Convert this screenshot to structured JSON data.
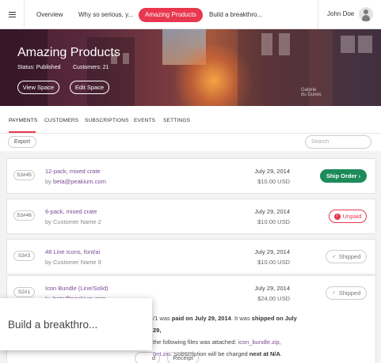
{
  "topnav": {
    "tabs": [
      {
        "label": "Overview"
      },
      {
        "label": "Why so serious, y..."
      },
      {
        "label": "Amazing Products",
        "active": true
      },
      {
        "label": "Build a breakthro..."
      }
    ],
    "user_name": "John Doe",
    "accent_color": "#e8374e"
  },
  "hero": {
    "title": "Amazing Products",
    "status": "Status: Published",
    "customers": "Customers: 21",
    "view_button": "View Space",
    "edit_button": "Edit Space",
    "sign_text": "Galerie\ndu Dunes"
  },
  "tabs": [
    {
      "label": "PAYMENTS",
      "active": true
    },
    {
      "label": "CUSTOMERS"
    },
    {
      "label": "SUBSCRIPTIONS"
    },
    {
      "label": "EVENTS"
    },
    {
      "label": "SETTINGS"
    }
  ],
  "toolbar": {
    "export_label": "Export",
    "search_placeholder": "Search"
  },
  "payments": [
    {
      "id": "S3#45",
      "product": "12-pack, mixed crate",
      "by": "by ",
      "customer": "beta@peakium.com",
      "date": "July 29, 2014",
      "price": "$10.00 USD",
      "action": "Ship Order",
      "action_glyph": "›"
    },
    {
      "id": "S3#46",
      "product": "6-pack, mixed crate",
      "by": "by Customer Name 2",
      "customer": "",
      "date": "July 29, 2014",
      "price": "$10.00 USD",
      "action": "Unpaid",
      "action_glyph": "!"
    },
    {
      "id": "S3#3",
      "product": "48 Line Icons, font/ai",
      "by": "by Customer Name 9",
      "customer": "",
      "date": "July 29, 2014",
      "price": "$10.00 USD",
      "action": "Shipped",
      "action_glyph": "✓"
    },
    {
      "id": "S2#1",
      "product": "Icon Bundle (Line/Solid)",
      "by": "by ",
      "customer": "beta@peakium.com",
      "date": "July 29, 2014",
      "price": "$24.00 USD",
      "action": "Shipped",
      "action_glyph": "✓"
    }
  ],
  "details": {
    "l1a": "/1 was ",
    "l1b": "paid on July 29, 2014",
    "l1c": ". It was ",
    "l1d": "shipped on July 29,",
    "l2a": "the following files was attached: ",
    "l2b": "icon_bundle.zip",
    "l2c": ",",
    "l3a": "ont.zip",
    "l3b": ". Subscription will be charged ",
    "l3c": "next at N/A",
    "l3d": ".",
    "btn1": "d",
    "btn2": "Receipt"
  },
  "tooltip": {
    "text": "Build a breakthro..."
  }
}
